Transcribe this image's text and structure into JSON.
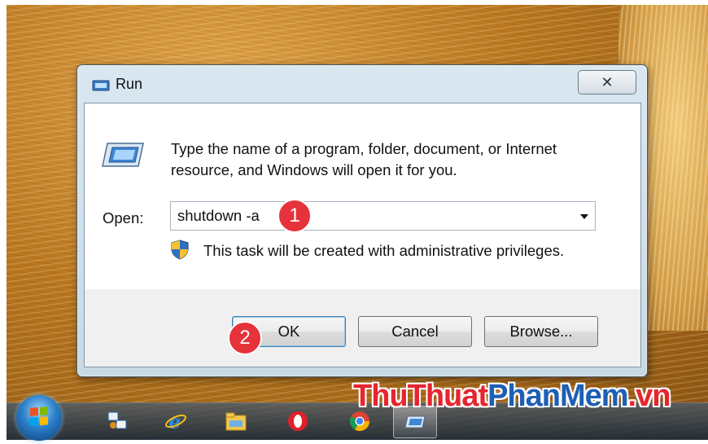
{
  "window": {
    "title": "Run",
    "close_symbol": "✕",
    "icon": "run-icon"
  },
  "dialog": {
    "description": "Type the name of a program, folder, document, or Internet resource, and Windows will open it for you.",
    "open_label": "Open:",
    "open_value": "shutdown -a",
    "admin_note": "This task will be created with administrative privileges."
  },
  "buttons": {
    "ok": "OK",
    "cancel": "Cancel",
    "browse": "Browse..."
  },
  "markers": [
    "1",
    "2"
  ],
  "watermark": {
    "part1": "ThuThuat",
    "part2": "PhanMem",
    "part3": ".vn"
  },
  "taskbar": {
    "items": [
      "start-orb-icon",
      "network-app-icon",
      "internet-explorer-icon",
      "file-explorer-icon",
      "opera-icon",
      "chrome-icon",
      "run-icon"
    ]
  },
  "colors": {
    "marker": "#e6323a",
    "watermark_red": "#e6252f",
    "watermark_blue": "#1d5fb4"
  }
}
